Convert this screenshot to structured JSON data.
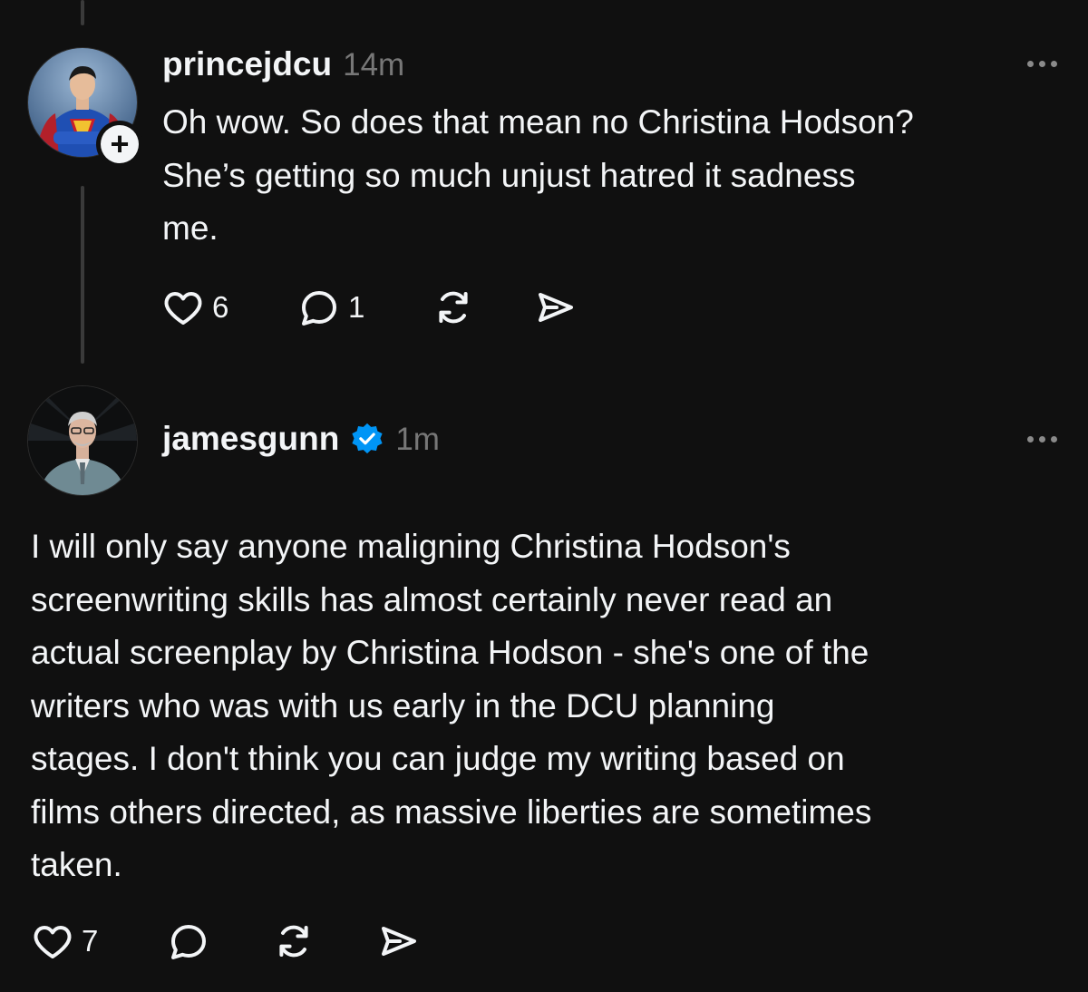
{
  "posts": [
    {
      "username": "princejdcu",
      "time": "14m",
      "text": "Oh wow. So does that mean no Christina Hodson?\nShe’s getting so much unjust hatred it sadness\nme.",
      "likes": "6",
      "replies": "1",
      "follow_symbol": "+",
      "avatar_icon": "superman-avatar",
      "icons": [
        "heart-icon",
        "comment-icon",
        "repost-icon",
        "share-icon",
        "more-icon",
        "plus-icon"
      ]
    },
    {
      "username": "jamesgunn",
      "time": "1m",
      "verified": true,
      "text": "I will only say anyone maligning Christina Hodson's\nscreenwriting skills has almost certainly never read an\nactual screenplay by Christina Hodson - she's one of the\nwriters who was with us early in the DCU planning\nstages. I don't think you can judge my writing based on\nfilms others directed, as massive liberties are sometimes\ntaken.",
      "likes": "7",
      "replies": "",
      "avatar_icon": "person-avatar",
      "icons": [
        "heart-icon",
        "comment-icon",
        "repost-icon",
        "share-icon",
        "more-icon",
        "verified-badge-icon"
      ]
    }
  ],
  "colors": {
    "background": "#101010",
    "text": "#f3f5f7",
    "muted": "#777777",
    "verified": "#0095f6",
    "thread_line": "#3a3a3a"
  }
}
